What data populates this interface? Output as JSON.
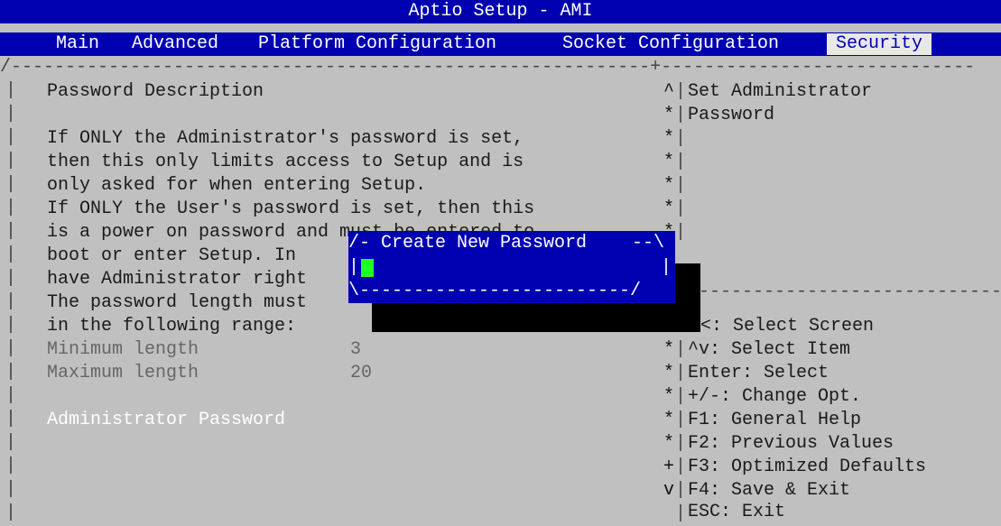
{
  "title": "Aptio Setup - AMI",
  "menu": {
    "items": [
      "Main",
      "Advanced",
      "Platform Configuration",
      "Socket Configuration",
      "Security"
    ],
    "active": "Security"
  },
  "left": {
    "lines": [
      "Password Description",
      "",
      "If ONLY the Administrator's password is set,",
      "then this only limits access to Setup and is",
      "only asked for when entering Setup.",
      "If ONLY the User's password is set, then this",
      "is a power on password and must be entered to",
      "boot or enter Setup. In",
      "have Administrator right",
      "The password length must",
      "in the following range:"
    ],
    "min_label": "Minimum length",
    "min_value": "3",
    "max_label": "Maximum length",
    "max_value": "20",
    "admin_password_label": "Administrator Password"
  },
  "help": {
    "lines": [
      "Set Administrator",
      "Password"
    ]
  },
  "keys": [
    "<: Select Screen",
    "^v: Select Item",
    "Enter: Select",
    "+/-: Change Opt.",
    "F1: General Help",
    "F2: Previous Values",
    "F3: Optimized Defaults",
    "F4: Save & Exit",
    "ESC: Exit"
  ],
  "scroll_marks_top": [
    "^",
    "*",
    "*",
    "*",
    "*",
    "*",
    "*"
  ],
  "scroll_marks_bottom": [
    "*",
    "*",
    "*",
    "*",
    "*",
    "+",
    "v"
  ],
  "popup": {
    "title": "Create New Password",
    "value": ""
  },
  "colors": {
    "background": "#c0c0c0",
    "header_blue": "#0000b0",
    "cursor_green": "#22ff22"
  }
}
